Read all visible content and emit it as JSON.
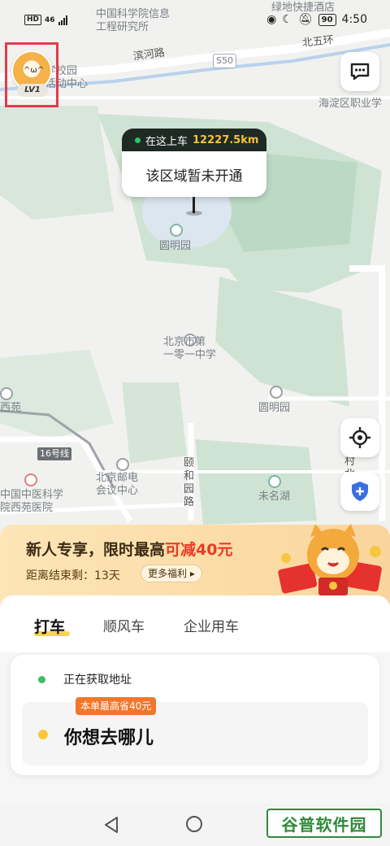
{
  "status_bar": {
    "hd": "HD",
    "network": "46",
    "battery": "90",
    "time": "4:50"
  },
  "avatar": {
    "level": "LV1"
  },
  "map": {
    "labels": {
      "institute": "中国科学院信息\n工程研究所",
      "hotel": "绿地快捷酒店",
      "binhe_road": "滨河路",
      "s50": "S50",
      "north5": "北五环",
      "school_left": "学校园\n活动中心",
      "haidian": "海淀区职业学",
      "yuanmingyuan_park": "圆明园",
      "beijing_101": "北京市第\n一零一中学",
      "yuanmingyuan_station": "圆明园",
      "xiyuan": "西苑",
      "line16": "16号线",
      "post_college": "北京邮电\n会议中心",
      "yiheyuan_road": "颐\n和\n园\n路",
      "weiming_lake": "未名湖",
      "tcm_hospital": "中国中医科学\n院西苑医院",
      "village": "村\n北"
    },
    "pickup": {
      "prefix": "在这上车",
      "distance": "12227.5km",
      "message": "该区域暂未开通"
    }
  },
  "promo": {
    "title_plain": "新人专享，限时最高",
    "title_highlight": "可减40元",
    "countdown": "距离结束剩：13天",
    "more_button": "更多福利 ▸"
  },
  "tabs": [
    {
      "label": "打车"
    },
    {
      "label": "顺风车"
    },
    {
      "label": "企业用车"
    }
  ],
  "trip": {
    "from_status": "正在获取地址",
    "save_tag": "本单最高省40元",
    "to_placeholder": "你想去哪儿"
  },
  "watermark": "谷普软件园",
  "colors": {
    "accent_yellow": "#fcd34d",
    "promo_red": "#ea3a24",
    "origin_green": "#3cbf62",
    "destination_yellow": "#fcc63b",
    "tag_orange": "#f2762b"
  }
}
